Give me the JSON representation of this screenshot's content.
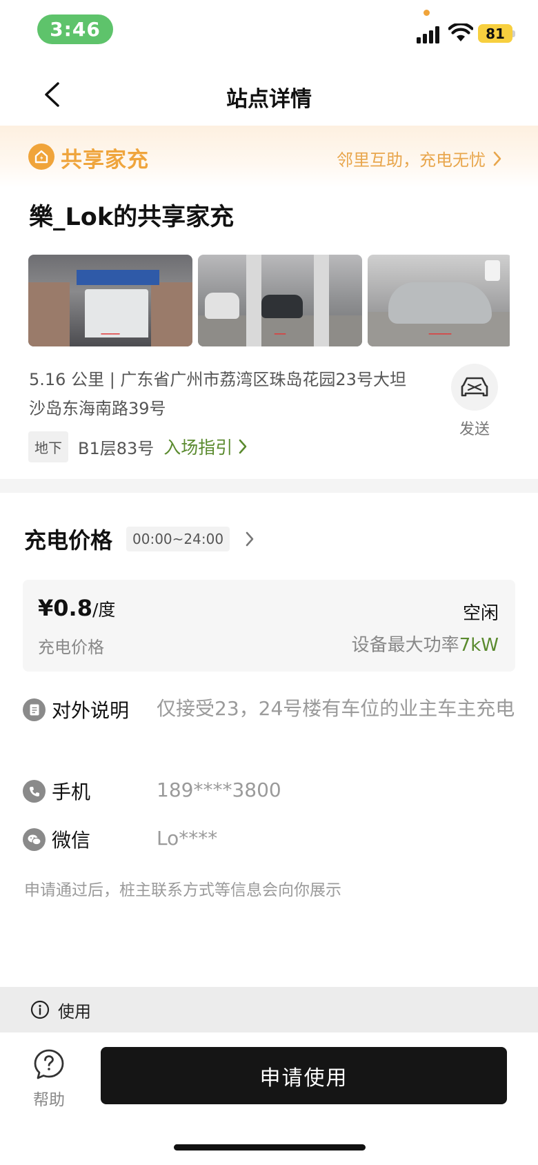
{
  "status_bar": {
    "time": "3:46",
    "battery": "81"
  },
  "nav": {
    "title": "站点详情"
  },
  "banner": {
    "title": "共享家充",
    "link_text": "邻里互助，充电无忧"
  },
  "station": {
    "title": "樂_Lok的共享家充",
    "photos": [
      {
        "icon": "parking-entrance-photo"
      },
      {
        "icon": "garage-lane-photo"
      },
      {
        "icon": "charging-spot-photo"
      }
    ],
    "address_line": "5.16 公里 | 广东省广州市荔湾区珠岛花园23号大坦沙岛东海南路39号",
    "send_label": "发送",
    "spot_tag": "地下",
    "spot_text": "B1层83号",
    "guide_link": "入场指引"
  },
  "price": {
    "heading": "充电价格",
    "time_range": "00:00~24:00",
    "value": "¥0.8",
    "unit": "/度",
    "label": "充电价格",
    "status": "空闲",
    "max_power_label": "设备最大功率",
    "max_power_value": "7kW"
  },
  "info": {
    "description_label": "对外说明",
    "description_value": "仅接受23，24号楼有车位的业主车主充电",
    "phone_label": "手机",
    "phone_value": "189****3800",
    "wechat_label": "微信",
    "wechat_value": "Lo****",
    "notice": "申请通过后，桩主联系方式等信息会向你展示"
  },
  "usage": {
    "label": "使用"
  },
  "bottom": {
    "help_label": "帮助",
    "apply_label": "申请使用"
  },
  "colors": {
    "accent_orange": "#efa53d",
    "accent_green": "#5a8a2e",
    "primary_button": "#151515"
  }
}
